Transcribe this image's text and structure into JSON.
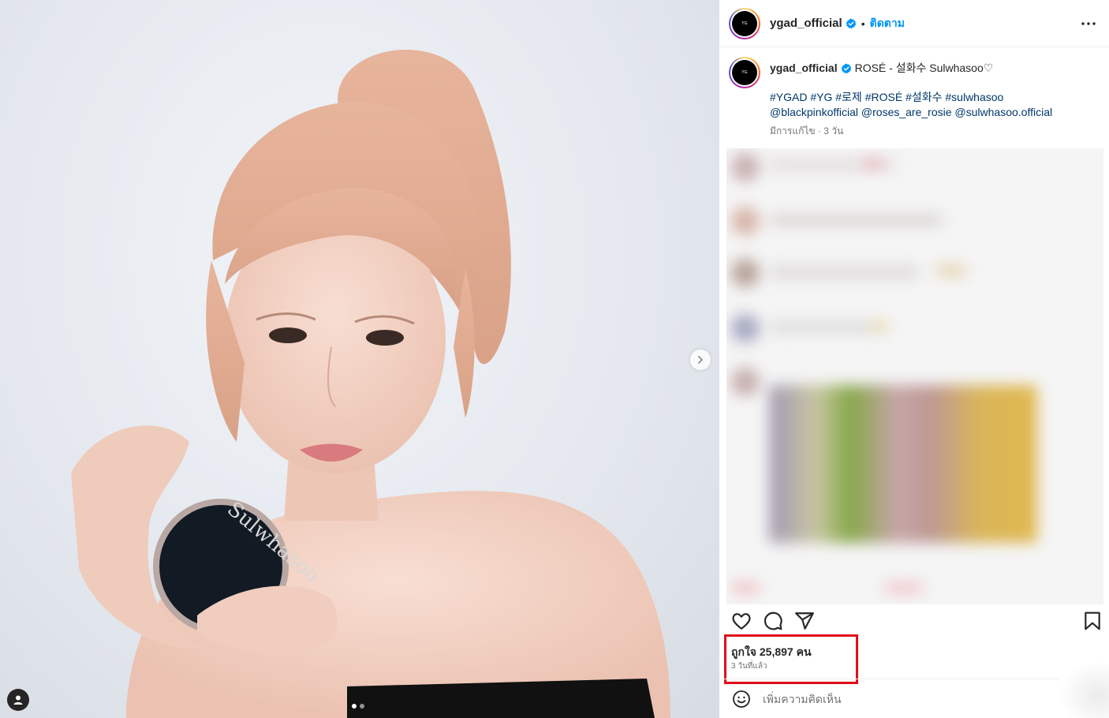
{
  "media": {
    "photo_description_icon": "portrait-photo",
    "product_brand_text": "Sulwhasoo",
    "carousel": {
      "current": 1,
      "total": 2
    },
    "next_icon": "chevron-right-icon",
    "tag_icon": "user-tag-icon"
  },
  "header": {
    "avatar_text": "YG",
    "username": "ygad_official",
    "separator": "•",
    "follow_label": "ติดตาม",
    "more_icon": "more-icon"
  },
  "caption": {
    "username": "ygad_official",
    "text": "ROSÉ - 설화수 Sulwhasoo♡",
    "hashtags": [
      "#YGAD",
      "#YG",
      "#로제",
      "#ROSÉ",
      "#설화수",
      "#sulwhasoo"
    ],
    "mentions": [
      "@blackpinkofficial",
      "@roses_are_rosie",
      "@sulwhasoo.official"
    ],
    "meta": "มีการแก้ไข · 3 วัน"
  },
  "actions": {
    "like_icon": "heart-icon",
    "comment_icon": "comment-icon",
    "share_icon": "share-icon",
    "save_icon": "bookmark-icon"
  },
  "stats": {
    "likes_label": "ถูกใจ 25,897 คน",
    "time_label": "3 วันที่แล้ว"
  },
  "comment_box": {
    "placeholder": "เพิ่มความคิดเห็น",
    "emoji_icon": "emoji-icon"
  },
  "colors": {
    "follow_blue": "#0095f6",
    "highlight_red": "#e00d1b",
    "hashtag_blue": "#00376b"
  }
}
